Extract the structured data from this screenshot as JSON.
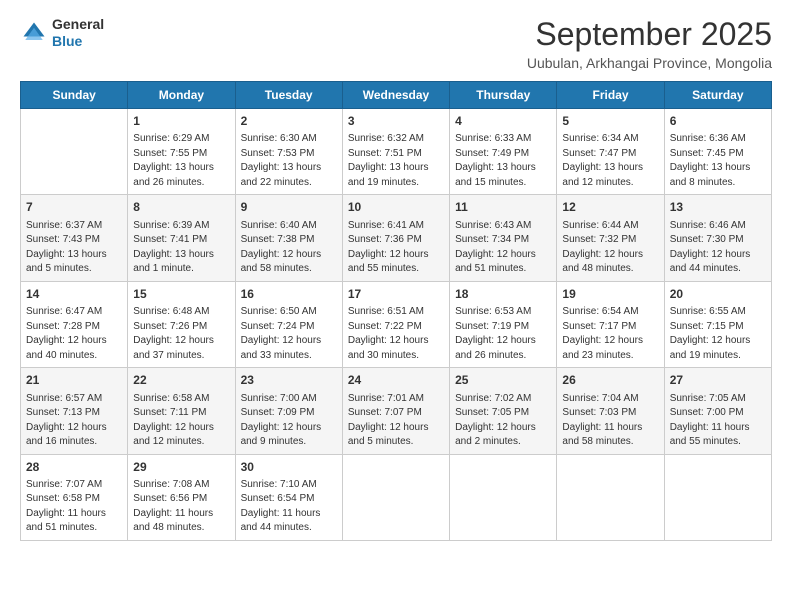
{
  "header": {
    "logo_general": "General",
    "logo_blue": "Blue",
    "month_year": "September 2025",
    "location": "Uubulan, Arkhangai Province, Mongolia"
  },
  "days_of_week": [
    "Sunday",
    "Monday",
    "Tuesday",
    "Wednesday",
    "Thursday",
    "Friday",
    "Saturday"
  ],
  "weeks": [
    [
      {
        "day": "",
        "sunrise": "",
        "sunset": "",
        "daylight": ""
      },
      {
        "day": "1",
        "sunrise": "Sunrise: 6:29 AM",
        "sunset": "Sunset: 7:55 PM",
        "daylight": "Daylight: 13 hours and 26 minutes."
      },
      {
        "day": "2",
        "sunrise": "Sunrise: 6:30 AM",
        "sunset": "Sunset: 7:53 PM",
        "daylight": "Daylight: 13 hours and 22 minutes."
      },
      {
        "day": "3",
        "sunrise": "Sunrise: 6:32 AM",
        "sunset": "Sunset: 7:51 PM",
        "daylight": "Daylight: 13 hours and 19 minutes."
      },
      {
        "day": "4",
        "sunrise": "Sunrise: 6:33 AM",
        "sunset": "Sunset: 7:49 PM",
        "daylight": "Daylight: 13 hours and 15 minutes."
      },
      {
        "day": "5",
        "sunrise": "Sunrise: 6:34 AM",
        "sunset": "Sunset: 7:47 PM",
        "daylight": "Daylight: 13 hours and 12 minutes."
      },
      {
        "day": "6",
        "sunrise": "Sunrise: 6:36 AM",
        "sunset": "Sunset: 7:45 PM",
        "daylight": "Daylight: 13 hours and 8 minutes."
      }
    ],
    [
      {
        "day": "7",
        "sunrise": "Sunrise: 6:37 AM",
        "sunset": "Sunset: 7:43 PM",
        "daylight": "Daylight: 13 hours and 5 minutes."
      },
      {
        "day": "8",
        "sunrise": "Sunrise: 6:39 AM",
        "sunset": "Sunset: 7:41 PM",
        "daylight": "Daylight: 13 hours and 1 minute."
      },
      {
        "day": "9",
        "sunrise": "Sunrise: 6:40 AM",
        "sunset": "Sunset: 7:38 PM",
        "daylight": "Daylight: 12 hours and 58 minutes."
      },
      {
        "day": "10",
        "sunrise": "Sunrise: 6:41 AM",
        "sunset": "Sunset: 7:36 PM",
        "daylight": "Daylight: 12 hours and 55 minutes."
      },
      {
        "day": "11",
        "sunrise": "Sunrise: 6:43 AM",
        "sunset": "Sunset: 7:34 PM",
        "daylight": "Daylight: 12 hours and 51 minutes."
      },
      {
        "day": "12",
        "sunrise": "Sunrise: 6:44 AM",
        "sunset": "Sunset: 7:32 PM",
        "daylight": "Daylight: 12 hours and 48 minutes."
      },
      {
        "day": "13",
        "sunrise": "Sunrise: 6:46 AM",
        "sunset": "Sunset: 7:30 PM",
        "daylight": "Daylight: 12 hours and 44 minutes."
      }
    ],
    [
      {
        "day": "14",
        "sunrise": "Sunrise: 6:47 AM",
        "sunset": "Sunset: 7:28 PM",
        "daylight": "Daylight: 12 hours and 40 minutes."
      },
      {
        "day": "15",
        "sunrise": "Sunrise: 6:48 AM",
        "sunset": "Sunset: 7:26 PM",
        "daylight": "Daylight: 12 hours and 37 minutes."
      },
      {
        "day": "16",
        "sunrise": "Sunrise: 6:50 AM",
        "sunset": "Sunset: 7:24 PM",
        "daylight": "Daylight: 12 hours and 33 minutes."
      },
      {
        "day": "17",
        "sunrise": "Sunrise: 6:51 AM",
        "sunset": "Sunset: 7:22 PM",
        "daylight": "Daylight: 12 hours and 30 minutes."
      },
      {
        "day": "18",
        "sunrise": "Sunrise: 6:53 AM",
        "sunset": "Sunset: 7:19 PM",
        "daylight": "Daylight: 12 hours and 26 minutes."
      },
      {
        "day": "19",
        "sunrise": "Sunrise: 6:54 AM",
        "sunset": "Sunset: 7:17 PM",
        "daylight": "Daylight: 12 hours and 23 minutes."
      },
      {
        "day": "20",
        "sunrise": "Sunrise: 6:55 AM",
        "sunset": "Sunset: 7:15 PM",
        "daylight": "Daylight: 12 hours and 19 minutes."
      }
    ],
    [
      {
        "day": "21",
        "sunrise": "Sunrise: 6:57 AM",
        "sunset": "Sunset: 7:13 PM",
        "daylight": "Daylight: 12 hours and 16 minutes."
      },
      {
        "day": "22",
        "sunrise": "Sunrise: 6:58 AM",
        "sunset": "Sunset: 7:11 PM",
        "daylight": "Daylight: 12 hours and 12 minutes."
      },
      {
        "day": "23",
        "sunrise": "Sunrise: 7:00 AM",
        "sunset": "Sunset: 7:09 PM",
        "daylight": "Daylight: 12 hours and 9 minutes."
      },
      {
        "day": "24",
        "sunrise": "Sunrise: 7:01 AM",
        "sunset": "Sunset: 7:07 PM",
        "daylight": "Daylight: 12 hours and 5 minutes."
      },
      {
        "day": "25",
        "sunrise": "Sunrise: 7:02 AM",
        "sunset": "Sunset: 7:05 PM",
        "daylight": "Daylight: 12 hours and 2 minutes."
      },
      {
        "day": "26",
        "sunrise": "Sunrise: 7:04 AM",
        "sunset": "Sunset: 7:03 PM",
        "daylight": "Daylight: 11 hours and 58 minutes."
      },
      {
        "day": "27",
        "sunrise": "Sunrise: 7:05 AM",
        "sunset": "Sunset: 7:00 PM",
        "daylight": "Daylight: 11 hours and 55 minutes."
      }
    ],
    [
      {
        "day": "28",
        "sunrise": "Sunrise: 7:07 AM",
        "sunset": "Sunset: 6:58 PM",
        "daylight": "Daylight: 11 hours and 51 minutes."
      },
      {
        "day": "29",
        "sunrise": "Sunrise: 7:08 AM",
        "sunset": "Sunset: 6:56 PM",
        "daylight": "Daylight: 11 hours and 48 minutes."
      },
      {
        "day": "30",
        "sunrise": "Sunrise: 7:10 AM",
        "sunset": "Sunset: 6:54 PM",
        "daylight": "Daylight: 11 hours and 44 minutes."
      },
      {
        "day": "",
        "sunrise": "",
        "sunset": "",
        "daylight": ""
      },
      {
        "day": "",
        "sunrise": "",
        "sunset": "",
        "daylight": ""
      },
      {
        "day": "",
        "sunrise": "",
        "sunset": "",
        "daylight": ""
      },
      {
        "day": "",
        "sunrise": "",
        "sunset": "",
        "daylight": ""
      }
    ]
  ]
}
